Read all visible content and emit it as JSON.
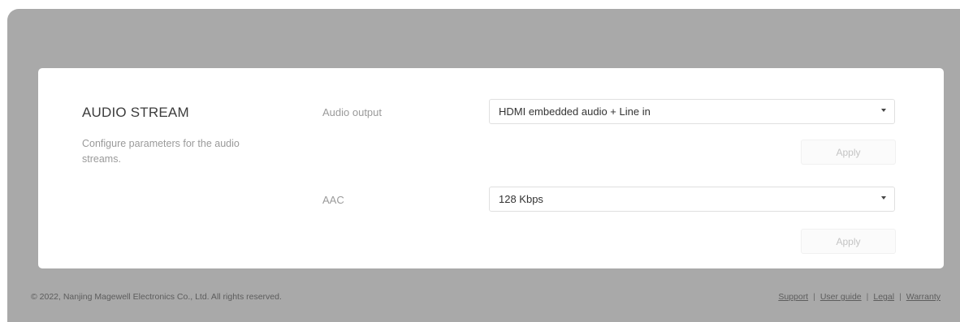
{
  "audio_stream": {
    "title": "AUDIO STREAM",
    "description": "Configure parameters for the audio streams.",
    "fields": [
      {
        "label": "Audio output",
        "value": "HDMI embedded audio + Line in",
        "apply_label": "Apply"
      },
      {
        "label": "AAC",
        "value": "128 Kbps",
        "apply_label": "Apply"
      }
    ]
  },
  "footer": {
    "copyright": "© 2022, Nanjing Magewell Electronics Co., Ltd. All rights reserved.",
    "links": [
      "Support",
      "User guide",
      "Legal",
      "Warranty"
    ],
    "separator": "|"
  },
  "colors": {
    "overlay_background": "#a9a9a9",
    "card_background": "#ffffff",
    "apply_disabled_text": "#c4c4c4"
  },
  "icons": {
    "select_caret": "caret-down-icon"
  }
}
